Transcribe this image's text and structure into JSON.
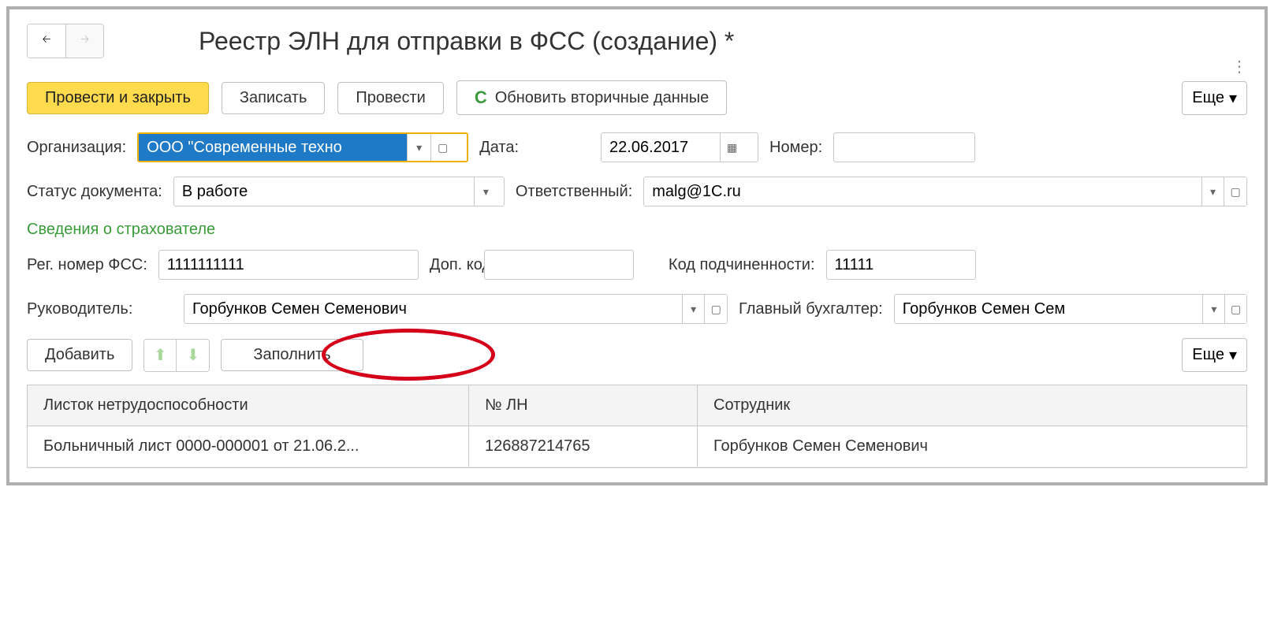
{
  "header": {
    "title": "Реестр ЭЛН для отправки в ФСС (создание) *"
  },
  "toolbar": {
    "post_and_close": "Провести и закрыть",
    "save": "Записать",
    "post": "Провести",
    "refresh_secondary": "Обновить вторичные данные",
    "more": "Еще"
  },
  "form": {
    "organization_label": "Организация:",
    "organization_value": "ООО \"Современные техно",
    "date_label": "Дата:",
    "date_value": "22.06.2017",
    "number_label": "Номер:",
    "number_value": "",
    "status_label": "Статус документа:",
    "status_value": "В работе",
    "responsible_label": "Ответственный:",
    "responsible_value": "malg@1C.ru",
    "section_title": "Сведения о страхователе",
    "reg_number_label": "Рег. номер ФСС:",
    "reg_number_value": "1111111111",
    "dop_code_label": "Доп. код:",
    "dop_code_value": "",
    "subord_code_label": "Код подчиненности:",
    "subord_code_value": "11111",
    "director_label": "Руководитель:",
    "director_value": "Горбунков Семен Семенович",
    "accountant_label": "Главный бухгалтер:",
    "accountant_value": "Горбунков Семен Сем"
  },
  "table_toolbar": {
    "add": "Добавить",
    "fill": "Заполнить",
    "more": "Еще"
  },
  "table": {
    "columns": {
      "c1": "Листок нетрудоспособности",
      "c2": "№ ЛН",
      "c3": "Сотрудник"
    },
    "rows": [
      {
        "c1": "Больничный лист 0000-000001 от 21.06.2...",
        "c2": "126887214765",
        "c3": "Горбунков Семен Семенович"
      }
    ]
  }
}
